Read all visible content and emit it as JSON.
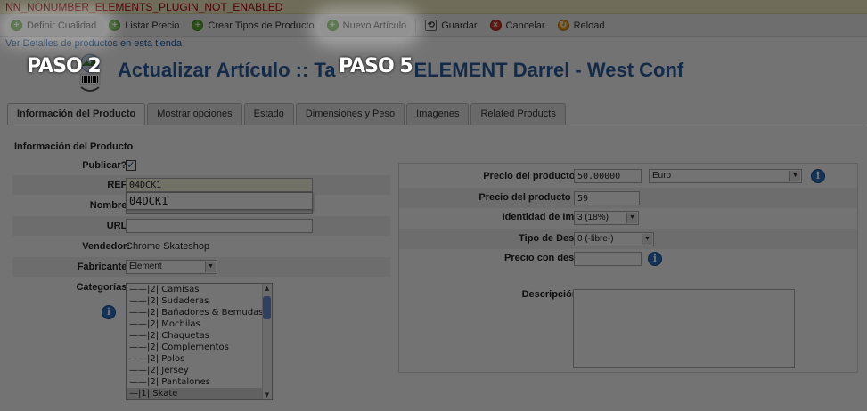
{
  "warning": "NN_NONUMBER_ELEMENTS_PLUGIN_NOT_ENABLED",
  "toolbar": {
    "definir": "Definir Cualidad",
    "listar": "Listar Precio",
    "crear": "Crear Tipos de Producto",
    "nuevo": "Nuevo Artículo",
    "guardar": "Guardar",
    "cancelar": "Cancelar",
    "reload": "Reload"
  },
  "link": "Ver Detalles de productos en esta tienda",
  "title": "Actualizar Artículo :: Ta",
  "title_tail": "ELEMENT Darrel - West Conf",
  "tabs": [
    "Información del Producto",
    "Mostrar opciones",
    "Estado",
    "Dimensiones y Peso",
    "Imagenes",
    "Related Products"
  ],
  "section_title": "Información del Producto",
  "form": {
    "publicar_label": "Publicar?:",
    "ref_label": "REF:",
    "ref_value": "04DCK1",
    "autocomplete": "04DCK1",
    "nombre_label": "Nombre:",
    "url_label": "URL:",
    "url_value": "",
    "vendedor_label": "Vendedor:",
    "vendedor_value": "Chrome Skateshop",
    "fabricante_label": "Fabricante:",
    "fabricante_value": "Element",
    "categorias_label": "Categorías:",
    "categories": [
      "——|2| Camisas",
      "——|2| Sudaderas",
      "——|2| Bañadores & Bemudas",
      "——|2| Mochilas",
      "——|2| Chaquetas",
      "——|2| Complementos",
      "——|2| Polos",
      "——|2| Jersey",
      "——|2| Pantalones",
      "—|1| Skate"
    ]
  },
  "pricing": {
    "neto_label": "Precio del producto (Neto):",
    "neto_value": "50.00000",
    "currency": "Euro",
    "bruto_label": "Precio del producto (Bruto):",
    "bruto_value": "59",
    "impuesto_label": "Identidad de Impuesto:",
    "impuesto_value": "3 (18%)",
    "descuento_label": "Tipo de Descuento:",
    "descuento_value": "0 (-libre-)",
    "precio_desc_label": "Precio con descuento:",
    "precio_desc_value": "",
    "desc_corta_label": "Descripción Corta:"
  },
  "callouts": {
    "paso2": "PASO 2",
    "paso5": "PASO 5"
  },
  "colors": {
    "title": "#2a5fa0",
    "link": "#1a5aa8",
    "warning": "#b8000c",
    "info": "#2c72c4"
  },
  "icons": [
    "plus-circle-icon",
    "save-icon",
    "cancel-icon",
    "reload-icon",
    "info-icon",
    "store-logo-icon"
  ]
}
